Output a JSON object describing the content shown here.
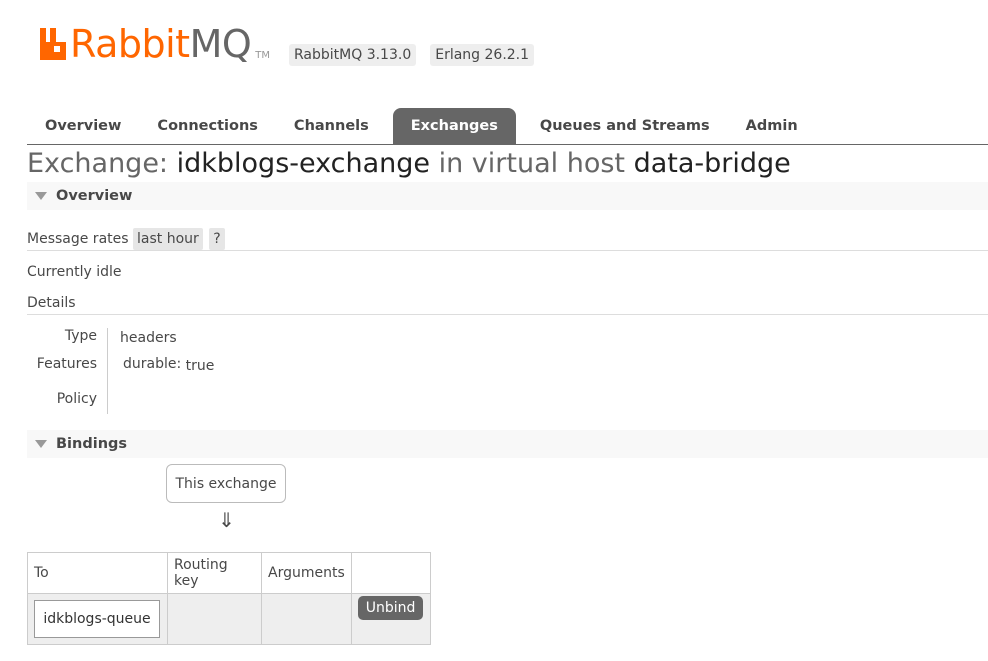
{
  "header": {
    "logo_text_rabbit": "Rabbit",
    "logo_text_mq": "MQ",
    "logo_tm": "TM",
    "rabbitmq_version": "RabbitMQ 3.13.0",
    "erlang_version": "Erlang 26.2.1",
    "brand_color": "#ff6600"
  },
  "tabs": [
    {
      "label": "Overview",
      "active": false
    },
    {
      "label": "Connections",
      "active": false
    },
    {
      "label": "Channels",
      "active": false
    },
    {
      "label": "Exchanges",
      "active": true
    },
    {
      "label": "Queues and Streams",
      "active": false
    },
    {
      "label": "Admin",
      "active": false
    }
  ],
  "title": {
    "prefix": "Exchange:",
    "exchange_name": "idkblogs-exchange",
    "middle": "in virtual host",
    "vhost": "data-bridge"
  },
  "overview": {
    "section_label": "Overview",
    "message_rates_label": "Message rates",
    "message_rates_range": "last hour",
    "help": "?",
    "status": "Currently idle",
    "details_label": "Details",
    "details": {
      "type_label": "Type",
      "type_value": "headers",
      "features_label": "Features",
      "feature_key": "durable:",
      "feature_value": "true",
      "policy_label": "Policy",
      "policy_value": ""
    }
  },
  "bindings": {
    "section_label": "Bindings",
    "this_exchange": "This exchange",
    "arrow": "⇓",
    "columns": [
      "To",
      "Routing key",
      "Arguments",
      ""
    ],
    "rows": [
      {
        "to": "idkblogs-queue",
        "routing_key": "",
        "arguments": "",
        "action": "Unbind"
      }
    ]
  }
}
